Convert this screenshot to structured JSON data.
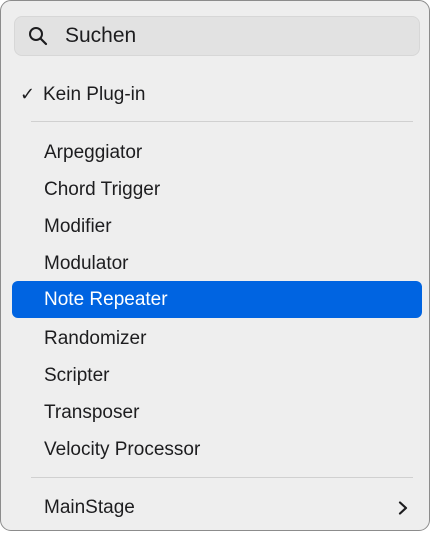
{
  "search": {
    "placeholder": "Suchen"
  },
  "checked_item": {
    "check_mark": "✓",
    "label": "Kein Plug-in"
  },
  "items": [
    {
      "label": "Arpeggiator"
    },
    {
      "label": "Chord Trigger"
    },
    {
      "label": "Modifier"
    },
    {
      "label": "Modulator"
    },
    {
      "label": "Note Repeater",
      "selected": true
    },
    {
      "label": "Randomizer"
    },
    {
      "label": "Scripter"
    },
    {
      "label": "Transposer"
    },
    {
      "label": "Velocity Processor"
    }
  ],
  "submenu_item": {
    "label": "MainStage",
    "icon": "chevron-right-icon"
  },
  "colors": {
    "accent": "#0064e1",
    "menu_background": "#eeeeee",
    "text": "#1d1d1f"
  }
}
